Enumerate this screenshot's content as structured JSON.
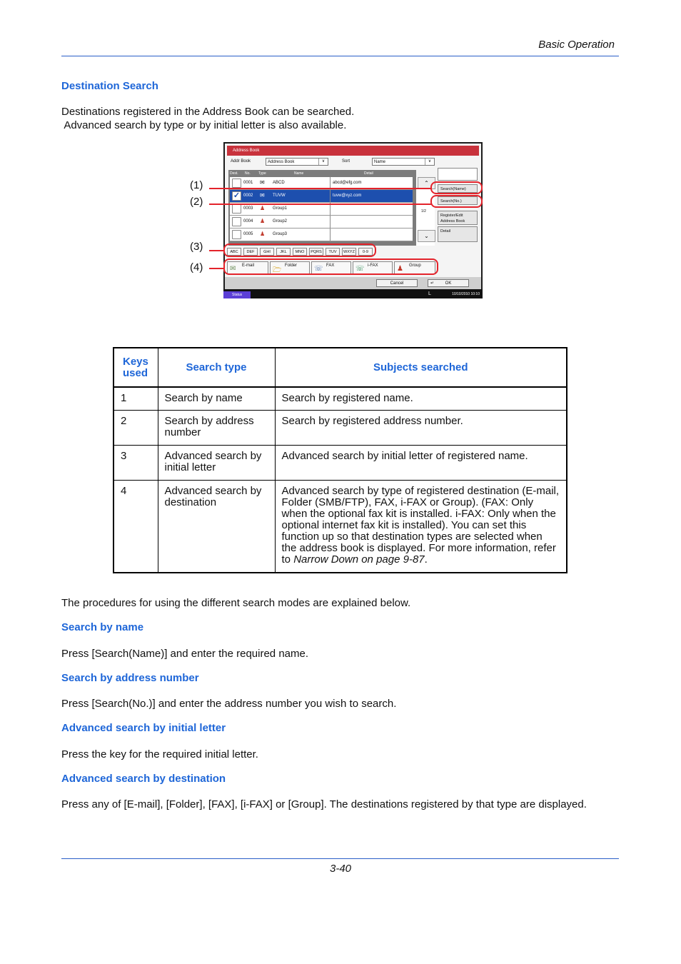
{
  "header": {
    "section_title": "Basic Operation"
  },
  "heading": "Destination Search",
  "intro": [
    "Destinations registered in the Address Book can be searched.",
    " Advanced search by type or by initial letter is also available."
  ],
  "screen": {
    "window_title": "Address Book",
    "addr_book_label": "Addr Book",
    "addr_book_value": "Address Book",
    "sort_label": "Sort",
    "sort_value": "Name",
    "columns": [
      "Dest.",
      "No.",
      "Type",
      "Name",
      "Detail"
    ],
    "rows": [
      {
        "checked": false,
        "no": "0001",
        "type": "email-icon",
        "name": "ABCD",
        "detail": "abcd@efg.com",
        "selected": false
      },
      {
        "checked": true,
        "no": "0002",
        "type": "email-icon",
        "name": "TUVW",
        "detail": "tuvw@xyz.com",
        "selected": true
      },
      {
        "checked": false,
        "no": "0003",
        "type": "group-icon",
        "name": "Group1",
        "detail": "",
        "selected": false
      },
      {
        "checked": false,
        "no": "0004",
        "type": "group-icon",
        "name": "Group2",
        "detail": "",
        "selected": false
      },
      {
        "checked": false,
        "no": "0005",
        "type": "group-icon",
        "name": "Group3",
        "detail": "",
        "selected": false
      }
    ],
    "page_indicator": "1/2",
    "side_buttons": {
      "search_name": "Search(Name)",
      "search_no": "Search(No.)",
      "register_edit_line1": "Register/Edit",
      "register_edit_line2": "Address Book",
      "detail": "Detail"
    },
    "letter_keys": [
      "ABC",
      "DEF",
      "GHI",
      "JKL",
      "MNO",
      "PQRS",
      "TUV",
      "WXYZ",
      "0-9"
    ],
    "type_buttons": [
      {
        "label": "E-mail",
        "icon": "envelope-icon"
      },
      {
        "label": "Folder",
        "icon": "folder-icon"
      },
      {
        "label": "FAX",
        "icon": "fax-icon"
      },
      {
        "label": "i-FAX",
        "icon": "ifax-icon"
      },
      {
        "label": "Group",
        "icon": "group-icon"
      }
    ],
    "cancel_label": "Cancel",
    "ok_label": "OK",
    "status_label": "Status",
    "status_indicator": "L",
    "datetime": "10/10/2010  10:10",
    "callouts": [
      "(1)",
      "(2)",
      "(3)",
      "(4)"
    ]
  },
  "table": {
    "headers": [
      "Keys used",
      "Search type",
      "Subjects searched"
    ],
    "rows": [
      {
        "key": "1",
        "type": "Search by name",
        "subject": "Search by registered name."
      },
      {
        "key": "2",
        "type": "Search by address number",
        "subject": "Search by registered address number."
      },
      {
        "key": "3",
        "type": "Advanced search by initial letter",
        "subject": "Advanced search by initial letter of registered name."
      },
      {
        "key": "4",
        "type": "Advanced search by destination",
        "subject": "Advanced search by type of registered destination (E-mail, Folder (SMB/FTP), FAX, i-FAX or Group). (FAX: Only when the optional fax kit is installed. i-FAX: Only when the optional internet fax kit is installed). You can set this function up so that destination types are selected when the address book is displayed. For more information, refer to ",
        "subject_ref": "Narrow Down on page 9-87",
        "subject_end": "."
      }
    ]
  },
  "procedures_intro": "The procedures for using the different search modes are explained below.",
  "sections": [
    {
      "heading": "Search by name",
      "text": "Press [Search(Name)] and enter the required name."
    },
    {
      "heading": "Search by address number",
      "text": "Press [Search(No.)] and enter the address number you wish to search."
    },
    {
      "heading": "Advanced search by initial letter",
      "text": "Press the key for the required initial letter."
    },
    {
      "heading": "Advanced search by destination",
      "text": "Press any of [E-mail], [Folder], [FAX], [i-FAX] or [Group]. The destinations registered by that type are displayed."
    }
  ],
  "footer": {
    "page_number": "3-40"
  }
}
